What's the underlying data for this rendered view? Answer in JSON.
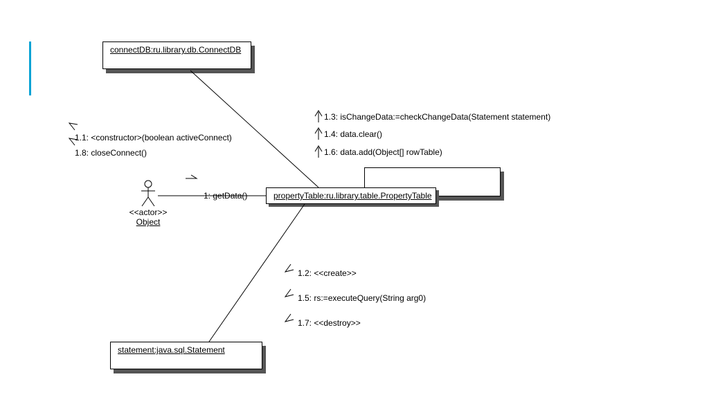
{
  "diagram_type": "uml_collaboration",
  "actor": {
    "stereotype": "<<actor>>",
    "name": "Object"
  },
  "objects": {
    "connectDB": "connectDB:ru.library.db.ConnectDB",
    "propertyTable": "propertyTable:ru.library.table.PropertyTable",
    "statement": "statement:java.sql.Statement"
  },
  "messages": {
    "m1": "1: getData()",
    "m1_1": "1.1: <constructor>(boolean activeConnect)",
    "m1_2": "1.2: <<create>>",
    "m1_3": "1.3: isChangeData:=checkChangeData(Statement statement)",
    "m1_4": "1.4: data.clear()",
    "m1_5": "1.5: rs:=executeQuery(String arg0)",
    "m1_6": "1.6: data.add(Object[] rowTable)",
    "m1_7": "1.7: <<destroy>>",
    "m1_8": "1.8: closeConnect()"
  }
}
